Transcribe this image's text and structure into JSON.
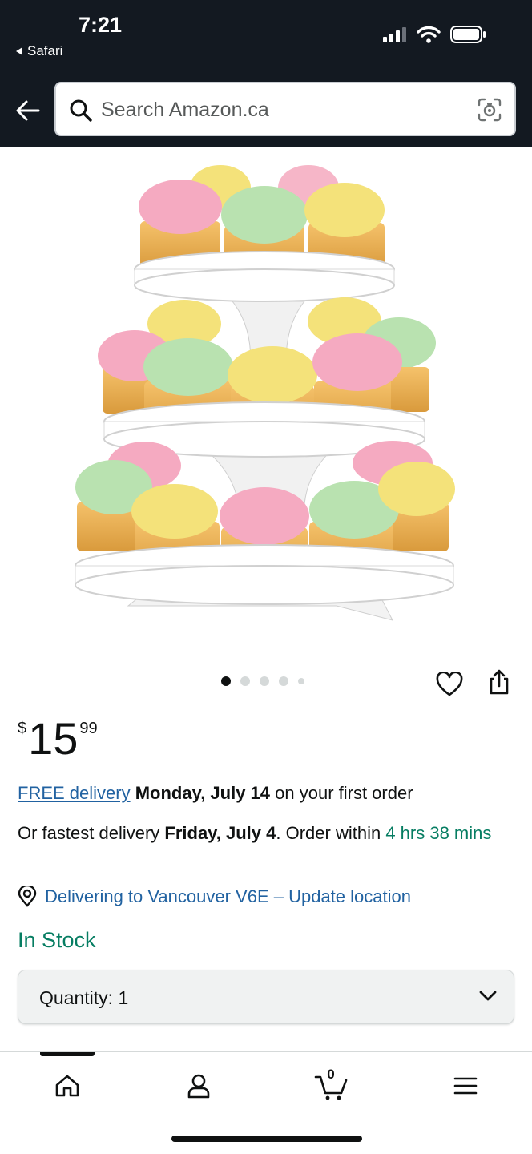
{
  "status_bar": {
    "time": "7:21",
    "back_app": "Safari"
  },
  "search": {
    "placeholder": "Search Amazon.ca"
  },
  "product": {
    "image_alt": "Three-tier cupcake stand with pastel frosted cupcakes",
    "carousel": {
      "count": 5,
      "active_index": 0
    }
  },
  "price": {
    "currency": "$",
    "whole": "15",
    "cents": "99"
  },
  "delivery": {
    "free_link": "FREE delivery",
    "free_date": "Monday, July 14",
    "free_suffix": " on your first order",
    "fast_prefix": "Or fastest delivery ",
    "fast_date": "Friday, July 4",
    "fast_mid": ". Order within ",
    "countdown": "4 hrs 38 mins",
    "location": "Delivering to Vancouver V6E – Update location"
  },
  "stock": "In Stock",
  "quantity": {
    "label": "Quantity: ",
    "value": "1"
  },
  "bottom_nav": {
    "cart_count": "0",
    "items": [
      "home-icon",
      "account-icon",
      "cart-icon",
      "menu-icon"
    ]
  },
  "colors": {
    "header_bg": "#131921",
    "link": "#2162a1",
    "success": "#067d62",
    "text": "#0f1111"
  }
}
